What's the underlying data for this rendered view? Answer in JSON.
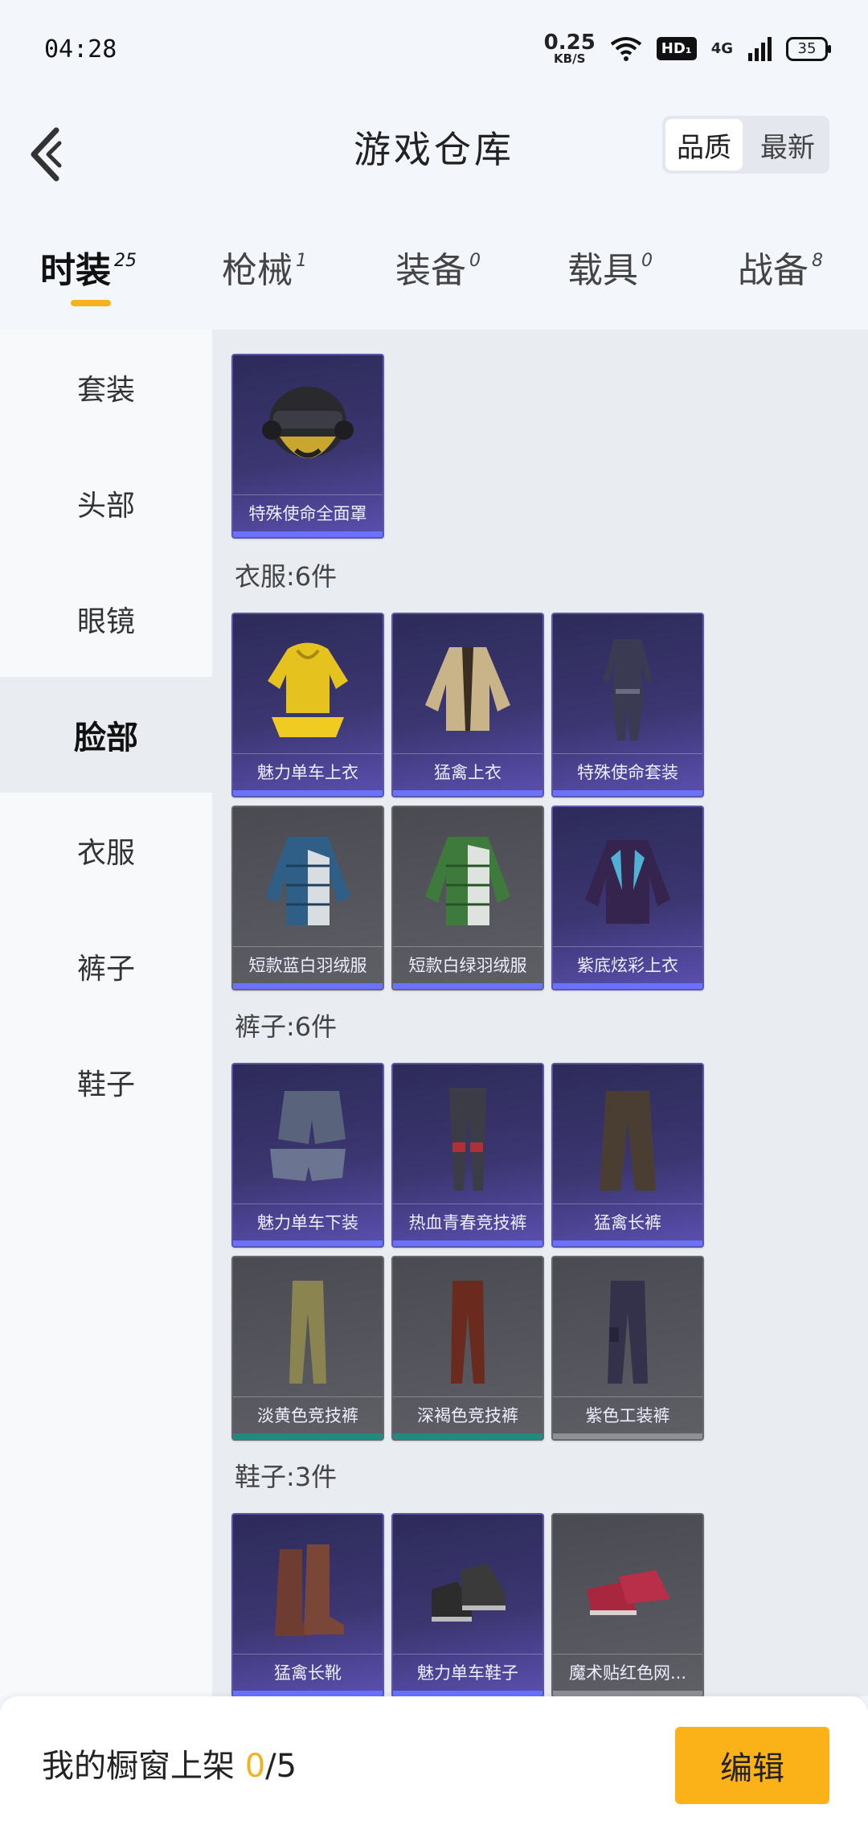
{
  "status": {
    "time": "04:28",
    "speed_value": "0.25",
    "speed_unit": "KB/S",
    "hd": "HD₁",
    "network": "4G",
    "battery": "35"
  },
  "header": {
    "title": "游戏仓库",
    "sort_quality": "品质",
    "sort_newest": "最新"
  },
  "tabs": [
    {
      "label": "时装",
      "count": "25"
    },
    {
      "label": "枪械",
      "count": "1"
    },
    {
      "label": "装备",
      "count": "0"
    },
    {
      "label": "载具",
      "count": "0"
    },
    {
      "label": "战备",
      "count": "8"
    }
  ],
  "sidebar": {
    "items": [
      "套装",
      "头部",
      "眼镜",
      "脸部",
      "衣服",
      "裤子",
      "鞋子"
    ],
    "active": "脸部"
  },
  "sections": {
    "face_items": [
      {
        "name": "特殊使命全面罩",
        "rarity": "purple",
        "icon": "helmet-icon"
      }
    ],
    "clothes_title": "衣服:6件",
    "clothes": [
      {
        "name": "魅力单车上衣",
        "rarity": "purple",
        "icon": "yellow-hoodie-icon"
      },
      {
        "name": "猛禽上衣",
        "rarity": "purple",
        "icon": "jacket-icon"
      },
      {
        "name": "特殊使命套装",
        "rarity": "purple",
        "icon": "suit-icon"
      },
      {
        "name": "短款蓝白羽绒服",
        "rarity": "blue",
        "icon": "down-jacket-icon"
      },
      {
        "name": "短款白绿羽绒服",
        "rarity": "blue",
        "icon": "green-down-jacket-icon"
      },
      {
        "name": "紫底炫彩上衣",
        "rarity": "blue",
        "icon": "purple-jacket-icon"
      }
    ],
    "pants_title": "裤子:6件",
    "pants": [
      {
        "name": "魅力单车下装",
        "rarity": "purple",
        "icon": "shorts-icon"
      },
      {
        "name": "热血青春竞技裤",
        "rarity": "purple",
        "icon": "leggings-icon"
      },
      {
        "name": "猛禽长裤",
        "rarity": "purple",
        "icon": "pants-icon"
      },
      {
        "name": "淡黄色竞技裤",
        "rarity": "teal",
        "icon": "khaki-pants-icon"
      },
      {
        "name": "深褐色竞技裤",
        "rarity": "teal",
        "icon": "brown-pants-icon"
      },
      {
        "name": "紫色工装裤",
        "rarity": "grey",
        "icon": "cargo-pants-icon"
      }
    ],
    "shoes_title": "鞋子:3件",
    "shoes": [
      {
        "name": "猛禽长靴",
        "rarity": "purple",
        "icon": "boots-icon"
      },
      {
        "name": "魅力单车鞋子",
        "rarity": "purple",
        "icon": "sneakers-icon"
      },
      {
        "name": "魔术贴红色网...",
        "rarity": "grey",
        "icon": "red-shoes-icon"
      }
    ]
  },
  "bottom": {
    "shelf_label": "我的橱窗上架 ",
    "shelf_current": "0",
    "shelf_total": "/5",
    "edit_label": "编辑"
  },
  "colors": {
    "accent": "#f5b21c",
    "purple_card": "#3b3670",
    "blue_bar": "#6a72ff",
    "teal_bar": "#1f8a80"
  }
}
